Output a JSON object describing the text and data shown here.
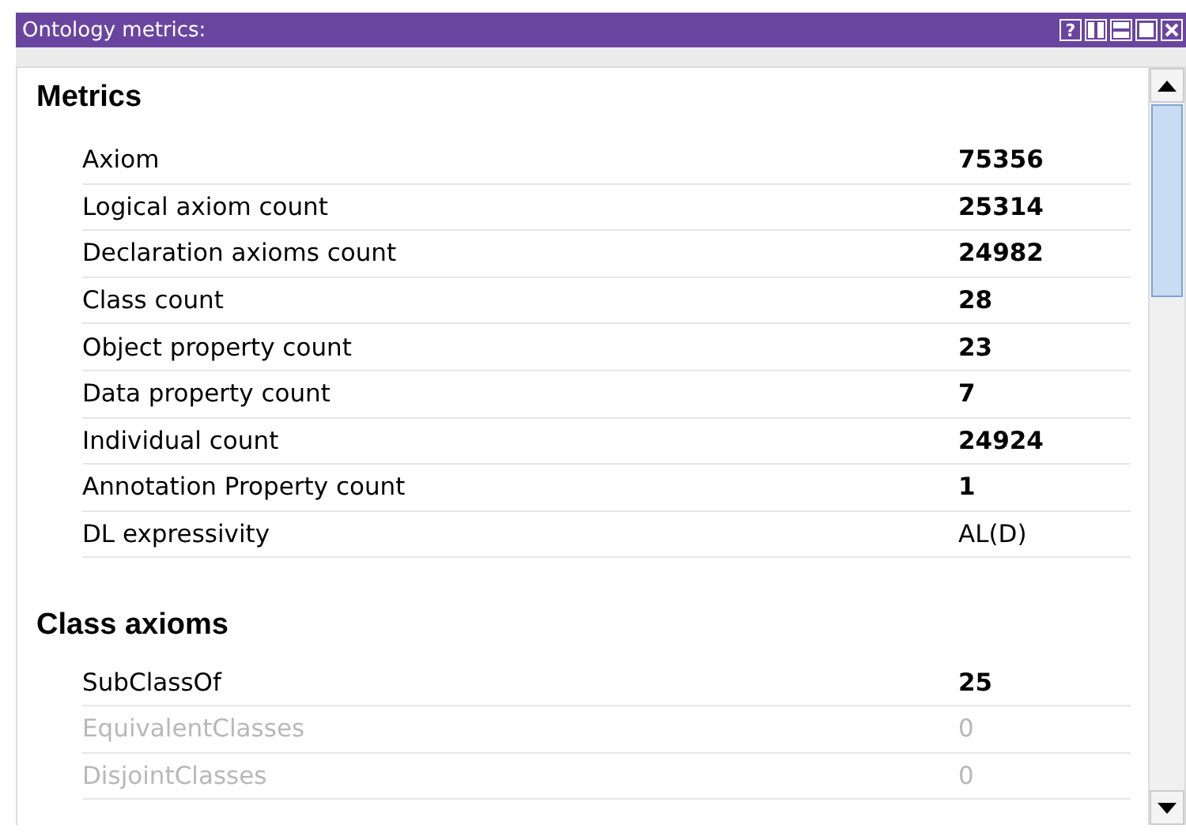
{
  "window": {
    "title": "Ontology metrics:",
    "buttons": [
      {
        "kind": "help",
        "label": "?"
      },
      {
        "kind": "split-vertical"
      },
      {
        "kind": "split-horizontal"
      },
      {
        "kind": "maximize"
      },
      {
        "kind": "close"
      }
    ]
  },
  "sections": [
    {
      "title": "Metrics",
      "rows": [
        {
          "label": "Axiom",
          "value": "75356",
          "bold": true,
          "disabled": false
        },
        {
          "label": "Logical axiom count",
          "value": "25314",
          "bold": true,
          "disabled": false
        },
        {
          "label": "Declaration axioms count",
          "value": "24982",
          "bold": true,
          "disabled": false
        },
        {
          "label": "Class count",
          "value": "28",
          "bold": true,
          "disabled": false
        },
        {
          "label": "Object property count",
          "value": "23",
          "bold": true,
          "disabled": false
        },
        {
          "label": "Data property count",
          "value": "7",
          "bold": true,
          "disabled": false
        },
        {
          "label": "Individual count",
          "value": "24924",
          "bold": true,
          "disabled": false
        },
        {
          "label": "Annotation Property count",
          "value": "1",
          "bold": true,
          "disabled": false
        },
        {
          "label": "DL expressivity",
          "value": "AL(D)",
          "bold": false,
          "disabled": false
        }
      ]
    },
    {
      "title": "Class axioms",
      "rows": [
        {
          "label": "SubClassOf",
          "value": "25",
          "bold": true,
          "disabled": false
        },
        {
          "label": "EquivalentClasses",
          "value": "0",
          "bold": false,
          "disabled": true
        },
        {
          "label": "DisjointClasses",
          "value": "0",
          "bold": false,
          "disabled": true
        }
      ]
    }
  ]
}
